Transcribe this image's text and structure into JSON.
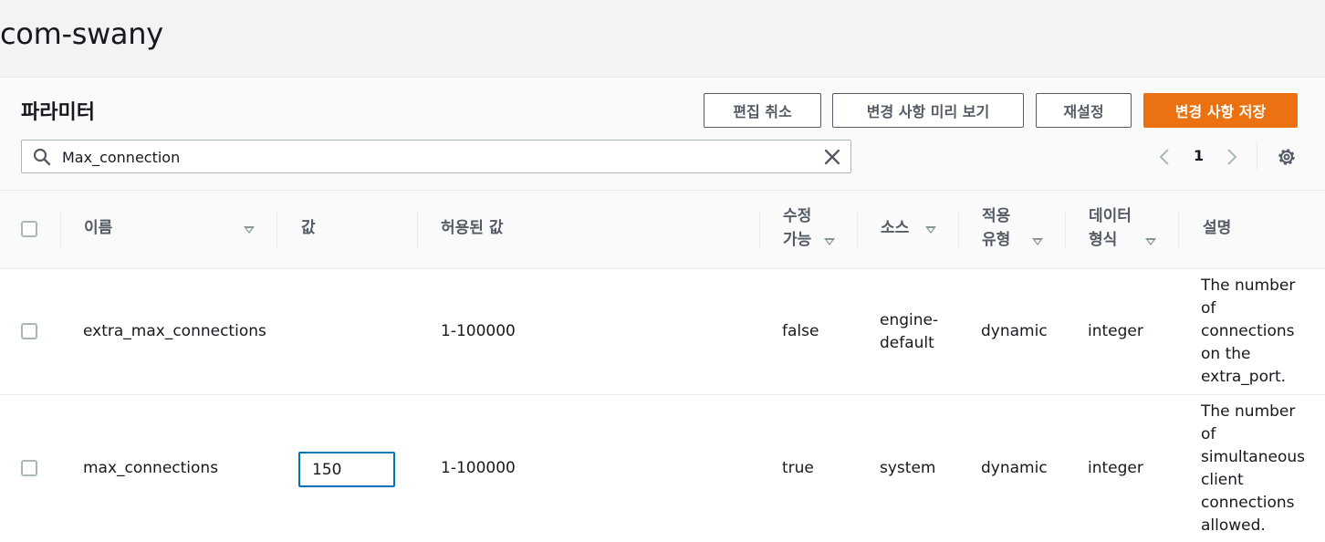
{
  "page": {
    "title": "com-swany"
  },
  "panel": {
    "title": "파라미터",
    "buttons": {
      "cancel_edit": "편집 취소",
      "preview_changes": "변경 사항 미리 보기",
      "reset": "재설정",
      "save_changes": "변경 사항 저장"
    },
    "search": {
      "value": "Max_connection"
    },
    "pagination": {
      "current_page": "1"
    },
    "colors": {
      "primary": "#ec7211",
      "focus": "#0073bb"
    }
  },
  "table": {
    "headers": {
      "name": "이름",
      "value": "값",
      "allowed": "허용된 값",
      "modifiable_1": "수정",
      "modifiable_2": "가능",
      "source": "소스",
      "apply_1": "적용",
      "apply_2": "유형",
      "datatype_1": "데이터",
      "datatype_2": "형식",
      "description": "설명"
    },
    "rows": [
      {
        "name": "extra_max_connections",
        "value": "",
        "allowed": "1-100000",
        "modifiable": "false",
        "source_1": "engine-",
        "source_2": "default",
        "apply_type": "dynamic",
        "data_type": "integer",
        "desc_lines": [
          "The number",
          "of",
          "connections",
          "on the",
          "extra_port."
        ]
      },
      {
        "name": "max_connections",
        "value": "150",
        "allowed": "1-100000",
        "modifiable": "true",
        "source": "system",
        "apply_type": "dynamic",
        "data_type": "integer",
        "desc_lines": [
          "The number",
          "of",
          "simultaneous",
          "client",
          "connections",
          "allowed."
        ]
      }
    ]
  }
}
